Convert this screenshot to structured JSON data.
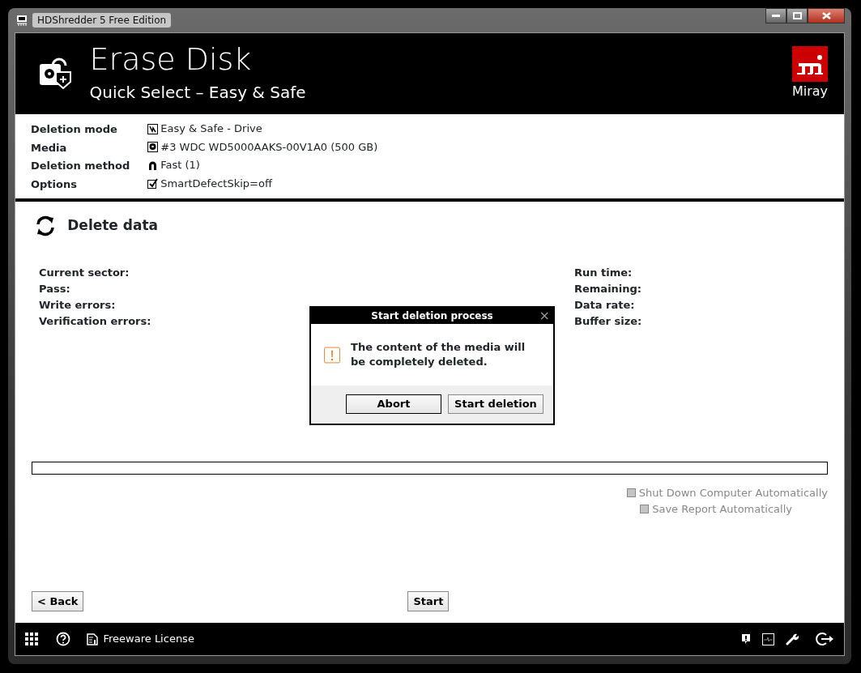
{
  "window": {
    "title": "HDShredder 5 Free Edition"
  },
  "header": {
    "title": "Erase Disk",
    "subtitle": "Quick Select – Easy & Safe",
    "brand": "Miray"
  },
  "summary": [
    {
      "label": "Deletion mode",
      "value": "Easy & Safe - Drive",
      "kind": "mode"
    },
    {
      "label": "Media",
      "value": "#3 WDC WD5000AAKS-00V1A0 (500 GB)",
      "kind": "disk"
    },
    {
      "label": "Deletion method",
      "value": "Fast (1)",
      "kind": "magnet"
    },
    {
      "label": "Options",
      "value": "SmartDefectSkip=off",
      "kind": "check"
    }
  ],
  "section": {
    "title": "Delete data"
  },
  "stats_left": [
    "Current sector:",
    "Pass:",
    "Write errors:",
    "Verification errors:"
  ],
  "stats_right": [
    "Run time:",
    "Remaining:",
    "Data rate:",
    "Buffer size:"
  ],
  "progress": {
    "level": 0
  },
  "options": [
    {
      "label": "Shut Down Computer Automatically",
      "checked": false,
      "disabled": true
    },
    {
      "label": "Save Report Automatically",
      "checked": false,
      "disabled": true
    }
  ],
  "buttons": {
    "back": "< Back",
    "start": "Start"
  },
  "footer": {
    "license": "Freeware License"
  },
  "dialog": {
    "title": "Start deletion process",
    "close": "×",
    "message": "The content of the media will be completely deleted.",
    "buttons": [
      "Abort",
      "Start deletion"
    ]
  }
}
